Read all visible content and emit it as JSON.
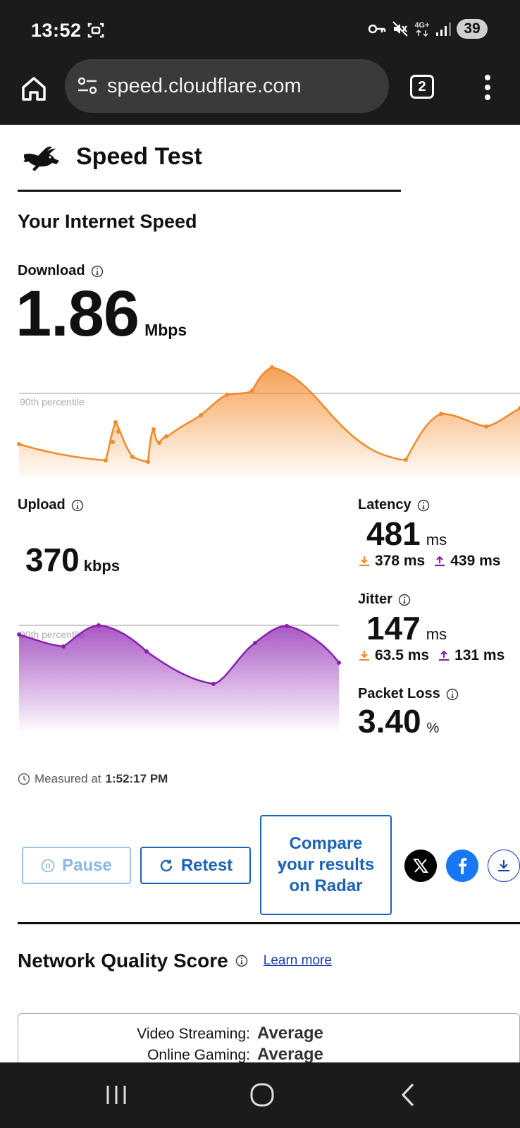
{
  "status_bar": {
    "time": "13:52",
    "network_type": "4G+",
    "battery": "39"
  },
  "browser": {
    "url": "speed.cloudflare.com",
    "tab_count": "2"
  },
  "header": {
    "title": "Speed Test"
  },
  "section_title": "Your Internet Speed",
  "download": {
    "label": "Download",
    "value": "1.86",
    "unit": "Mbps",
    "percentile_label": "90th percentile",
    "color": "#f28a2a"
  },
  "upload": {
    "label": "Upload",
    "value": "370",
    "unit": "kbps",
    "percentile_label": "90th percentile",
    "color": "#8b1fb0"
  },
  "latency": {
    "label": "Latency",
    "value": "481",
    "unit": "ms",
    "down": "378 ms",
    "up": "439 ms"
  },
  "jitter": {
    "label": "Jitter",
    "value": "147",
    "unit": "ms",
    "down": "63.5 ms",
    "up": "131 ms"
  },
  "packet_loss": {
    "label": "Packet Loss",
    "value": "3.40",
    "unit": "%"
  },
  "measured": {
    "prefix": "Measured at",
    "time": "1:52:17 PM"
  },
  "actions": {
    "pause": "Pause",
    "retest": "Retest",
    "compare": "Compare your results on Radar"
  },
  "network_quality": {
    "title": "Network Quality Score",
    "learn_more": "Learn more",
    "rows": [
      {
        "key": "Video Streaming:",
        "value": "Average"
      },
      {
        "key": "Online Gaming:",
        "value": "Average"
      }
    ]
  }
}
